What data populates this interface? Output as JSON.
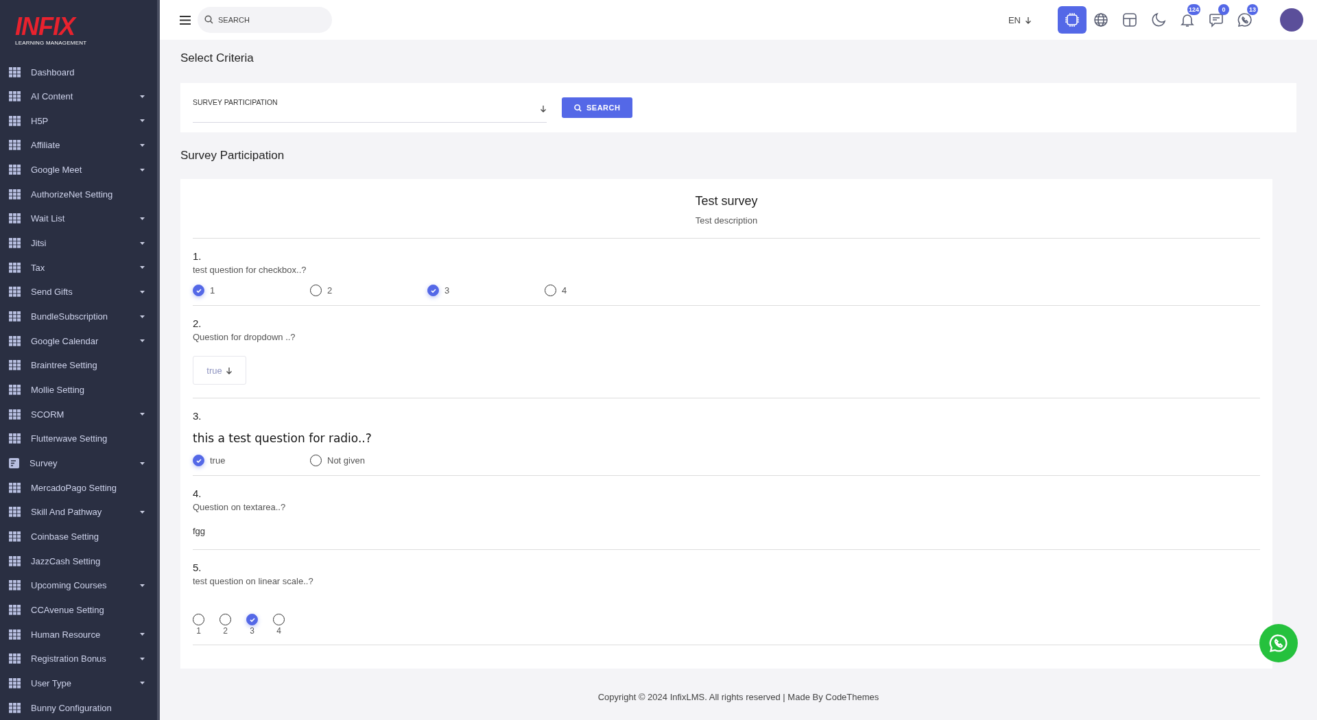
{
  "sidebar": {
    "logo": {
      "wordmark": "INFIX",
      "tagline": "LEARNING MANAGEMENT"
    },
    "items": [
      {
        "label": "Dashboard",
        "kind": "grid",
        "has_submenu": false
      },
      {
        "label": "AI Content",
        "kind": "grid",
        "has_submenu": true
      },
      {
        "label": "H5P",
        "kind": "grid",
        "has_submenu": true
      },
      {
        "label": "Affiliate",
        "kind": "grid",
        "has_submenu": true
      },
      {
        "label": "Google Meet",
        "kind": "grid",
        "has_submenu": true
      },
      {
        "label": "AuthorizeNet Setting",
        "kind": "grid",
        "has_submenu": false
      },
      {
        "label": "Wait List",
        "kind": "grid",
        "has_submenu": true
      },
      {
        "label": "Jitsi",
        "kind": "grid",
        "has_submenu": true
      },
      {
        "label": "Tax",
        "kind": "grid",
        "has_submenu": true
      },
      {
        "label": "Send Gifts",
        "kind": "grid",
        "has_submenu": true
      },
      {
        "label": "BundleSubscription",
        "kind": "grid",
        "has_submenu": true
      },
      {
        "label": "Google Calendar",
        "kind": "grid",
        "has_submenu": true
      },
      {
        "label": "Braintree Setting",
        "kind": "grid",
        "has_submenu": false
      },
      {
        "label": "Mollie Setting",
        "kind": "grid",
        "has_submenu": false
      },
      {
        "label": "SCORM",
        "kind": "grid",
        "has_submenu": true
      },
      {
        "label": "Flutterwave Setting",
        "kind": "grid",
        "has_submenu": false
      },
      {
        "label": "Survey",
        "kind": "document",
        "has_submenu": true
      },
      {
        "label": "MercadoPago Setting",
        "kind": "grid",
        "has_submenu": false
      },
      {
        "label": "Skill And Pathway",
        "kind": "grid",
        "has_submenu": true
      },
      {
        "label": "Coinbase Setting",
        "kind": "grid",
        "has_submenu": false
      },
      {
        "label": "JazzCash Setting",
        "kind": "grid",
        "has_submenu": false
      },
      {
        "label": "Upcoming Courses",
        "kind": "grid",
        "has_submenu": true
      },
      {
        "label": "CCAvenue Setting",
        "kind": "grid",
        "has_submenu": false
      },
      {
        "label": "Human Resource",
        "kind": "grid",
        "has_submenu": true
      },
      {
        "label": "Registration Bonus",
        "kind": "grid",
        "has_submenu": true
      },
      {
        "label": "User Type",
        "kind": "grid",
        "has_submenu": true
      },
      {
        "label": "Bunny Configuration",
        "kind": "grid",
        "has_submenu": false
      }
    ]
  },
  "topbar": {
    "search": {
      "placeholder": "SEARCH"
    },
    "language": "EN",
    "icons": [
      {
        "kind": "ai",
        "active": true
      },
      {
        "kind": "globe",
        "active": false
      },
      {
        "kind": "layout",
        "active": false
      },
      {
        "kind": "moon",
        "active": false
      },
      {
        "kind": "bell",
        "active": false,
        "badge": "124"
      },
      {
        "kind": "chat",
        "active": false,
        "badge": "0"
      },
      {
        "kind": "phone-chat",
        "active": false,
        "badge": "13"
      }
    ]
  },
  "criteria": {
    "title": "Select Criteria",
    "select": {
      "value": "SURVEY PARTICIPATION"
    },
    "button": "SEARCH"
  },
  "survey": {
    "heading": "Survey Participation",
    "title": "Test survey",
    "description": "Test description",
    "questions": [
      {
        "number": "1.",
        "text": "test question for checkbox..?",
        "large_text": false,
        "kind": "checkbox",
        "options": [
          {
            "label": "1",
            "checked": true
          },
          {
            "label": "2",
            "checked": false
          },
          {
            "label": "3",
            "checked": true
          },
          {
            "label": "4",
            "checked": false
          }
        ]
      },
      {
        "number": "2.",
        "text": "Question for dropdown ..?",
        "large_text": false,
        "kind": "dropdown",
        "value": "true"
      },
      {
        "number": "3.",
        "text": "this a test question for radio..?",
        "large_text": true,
        "kind": "radio",
        "options": [
          {
            "label": "true",
            "checked": true
          },
          {
            "label": "Not given",
            "checked": false
          }
        ]
      },
      {
        "number": "4.",
        "text": "Question on textarea..?",
        "large_text": false,
        "kind": "text",
        "answer": "fgg"
      },
      {
        "number": "5.",
        "text": "test question on linear scale..?",
        "large_text": false,
        "kind": "scale",
        "options": [
          {
            "label": "1",
            "checked": false
          },
          {
            "label": "2",
            "checked": false
          },
          {
            "label": "3",
            "checked": true
          },
          {
            "label": "4",
            "checked": false
          }
        ]
      }
    ]
  },
  "footer": "Copyright © 2024 InfixLMS. All rights reserved | Made By CodeThemes"
}
